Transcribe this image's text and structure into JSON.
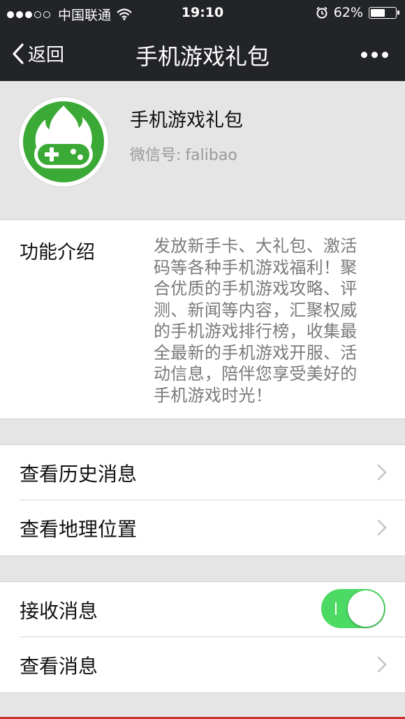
{
  "status_bar": {
    "carrier": "中国联通",
    "time": "19:10",
    "battery_percent": "62%",
    "battery_level": 0.62
  },
  "nav": {
    "back_label": "返回",
    "title": "手机游戏礼包"
  },
  "profile": {
    "name": "手机游戏礼包",
    "wechat_id_label": "微信号:",
    "wechat_id": "falibao"
  },
  "intro": {
    "label": "功能介绍",
    "lines": [
      "发放新手卡、大礼包、激活",
      "码等各种手机游戏福利！聚",
      "合优质的手机游戏攻略、评",
      "测、新闻等内容，汇聚权威",
      "的手机游戏排行榜，收集最",
      "全最新的手机游戏开服、活",
      "动信息，陪伴您享受美好的",
      "手机游戏时光！"
    ]
  },
  "menu": {
    "history_label": "查看历史消息",
    "location_label": "查看地理位置",
    "receive_label": "接收消息",
    "receive_enabled": true,
    "view_messages_label": "查看消息"
  },
  "colors": {
    "bar": "#222427",
    "toggle_on": "#4cd964",
    "logo_green": "#3aa935"
  }
}
